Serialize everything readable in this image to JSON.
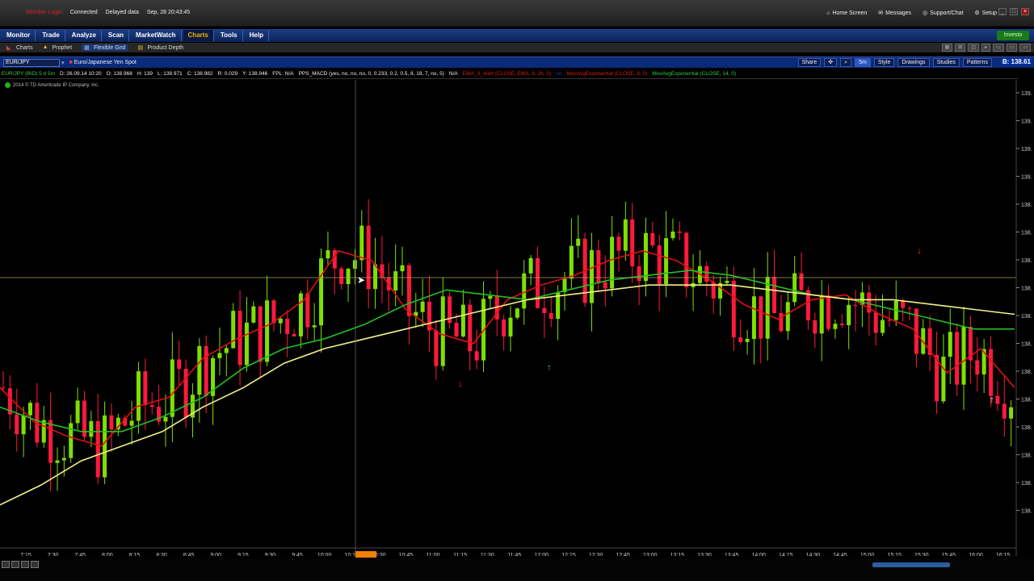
{
  "titlebar": {
    "member_login": "Member Login",
    "connection": "Connected",
    "data_status": "Delayed data",
    "datetime": "Sep, 28 20:43:45",
    "links": [
      "Home Screen",
      "Messages",
      "Support/Chat",
      "Setup"
    ]
  },
  "main_tabs": [
    "Monitor",
    "Trade",
    "Analyze",
    "Scan",
    "MarketWatch",
    "Charts",
    "Tools",
    "Help"
  ],
  "active_tab": "Charts",
  "investools": "Investo",
  "sub_tabs": [
    "Charts",
    "Prophet",
    "Flexible Grid",
    "Product Depth"
  ],
  "symbol": {
    "value": "EUR/JPY",
    "description": "Euro/Japanese Yen Spot",
    "last_price": "B: 138.61"
  },
  "chart_tools": [
    "Share",
    "5m",
    "Style",
    "Drawings",
    "Studies",
    "Patterns"
  ],
  "study_header": {
    "symbol_info": "EUR/JPY (BID) 5 d 5m",
    "date": "D: 26.09.14 10:20",
    "open": "O: 138.968",
    "high": "H: 139",
    "low": "L: 138.971",
    "close": "C: 138.982",
    "range": "R: 0.029",
    "y": "Y: 138.946",
    "fpl": "FPL: N/A",
    "macd": "PPS_MACD (yes, no, no, no, 0, 0.233, 0.2, 0.5, 8, 18, 7, no, 5)",
    "macd_val": "N/A",
    "ema_alert": "EMA_3_Alert (CLOSE, EMA, 8, 26, 0)",
    "ema_alert_val": "no",
    "ema_exp1": "MovAvgExponential (CLOSE, 8, 0)",
    "ema_exp2": "MovAvgExponential (CLOSE, 14, 0)"
  },
  "copyright": "2014 © TD Ameritrade IP Company, Inc.",
  "colors": {
    "bull": "#7fe000",
    "bear": "#ff1a3c",
    "ema_red": "#e01010",
    "ema_green": "#20c020",
    "ema_yellow": "#f2f28a"
  },
  "chart_data": {
    "type": "candlestick",
    "symbol": "EUR/JPY",
    "x": [
      "7:15",
      "7:30",
      "7:45",
      "8:00",
      "8:15",
      "8:30",
      "8:45",
      "9:00",
      "9:15",
      "9:30",
      "9:45",
      "10:00",
      "10:15",
      "10:30",
      "10:45",
      "11:00",
      "11:15",
      "11:30",
      "11:45",
      "12:00",
      "12:15",
      "12:30",
      "12:45",
      "13:00",
      "13:15",
      "13:30",
      "13:45",
      "14:00",
      "14:15",
      "14:30",
      "14:45",
      "15:00",
      "15:15",
      "15:30",
      "15:45",
      "16:00",
      "16:15"
    ],
    "crosshair_time": "10:20",
    "series": [
      {
        "name": "MovAvgExponential (CLOSE, 8, 0)",
        "color": "red",
        "values": [
          138.62,
          138.55,
          138.52,
          138.5,
          138.58,
          138.6,
          138.68,
          138.72,
          138.75,
          138.8,
          138.9,
          138.88,
          138.78,
          138.73,
          138.71,
          138.8,
          138.83,
          138.85,
          138.88,
          138.9,
          138.88,
          138.84,
          138.79,
          138.76,
          138.8,
          138.81,
          138.77,
          138.74,
          138.65,
          138.7,
          138.62
        ]
      },
      {
        "name": "MovAvgExponential (CLOSE, 14, 0)",
        "color": "green",
        "values": [
          138.58,
          138.55,
          138.53,
          138.53,
          138.56,
          138.6,
          138.66,
          138.7,
          138.72,
          138.75,
          138.79,
          138.82,
          138.81,
          138.8,
          138.82,
          138.84,
          138.85,
          138.86,
          138.85,
          138.83,
          138.81,
          138.8,
          138.78,
          138.76,
          138.74,
          138.74
        ]
      },
      {
        "name": "EMA_3_Alert",
        "color": "yellow",
        "values": [
          138.38,
          138.42,
          138.47,
          138.5,
          138.53,
          138.58,
          138.62,
          138.67,
          138.7,
          138.72,
          138.74,
          138.76,
          138.78,
          138.8,
          138.81,
          138.82,
          138.83,
          138.83,
          138.83,
          138.82,
          138.81,
          138.8,
          138.8,
          138.79,
          138.78,
          138.77
        ]
      }
    ],
    "y_axis_labels": [
      "139.",
      "139.",
      "139.",
      "139.",
      "138.",
      "138.",
      "138.",
      "138.",
      "138.",
      "138.",
      "138.",
      "138.",
      "138.",
      "138.",
      "138.",
      "138."
    ],
    "grid": false,
    "legend": "top-left"
  }
}
